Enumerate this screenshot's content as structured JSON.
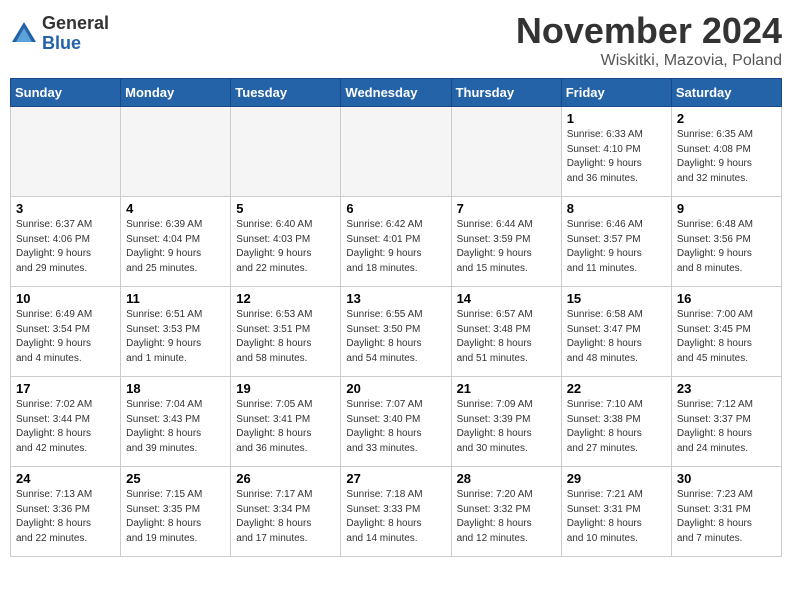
{
  "header": {
    "logo_general": "General",
    "logo_blue": "Blue",
    "month_title": "November 2024",
    "location": "Wiskitki, Mazovia, Poland"
  },
  "weekdays": [
    "Sunday",
    "Monday",
    "Tuesday",
    "Wednesday",
    "Thursday",
    "Friday",
    "Saturday"
  ],
  "weeks": [
    [
      {
        "num": "",
        "info": "",
        "empty": true
      },
      {
        "num": "",
        "info": "",
        "empty": true
      },
      {
        "num": "",
        "info": "",
        "empty": true
      },
      {
        "num": "",
        "info": "",
        "empty": true
      },
      {
        "num": "",
        "info": "",
        "empty": true
      },
      {
        "num": "1",
        "info": "Sunrise: 6:33 AM\nSunset: 4:10 PM\nDaylight: 9 hours\nand 36 minutes."
      },
      {
        "num": "2",
        "info": "Sunrise: 6:35 AM\nSunset: 4:08 PM\nDaylight: 9 hours\nand 32 minutes."
      }
    ],
    [
      {
        "num": "3",
        "info": "Sunrise: 6:37 AM\nSunset: 4:06 PM\nDaylight: 9 hours\nand 29 minutes."
      },
      {
        "num": "4",
        "info": "Sunrise: 6:39 AM\nSunset: 4:04 PM\nDaylight: 9 hours\nand 25 minutes."
      },
      {
        "num": "5",
        "info": "Sunrise: 6:40 AM\nSunset: 4:03 PM\nDaylight: 9 hours\nand 22 minutes."
      },
      {
        "num": "6",
        "info": "Sunrise: 6:42 AM\nSunset: 4:01 PM\nDaylight: 9 hours\nand 18 minutes."
      },
      {
        "num": "7",
        "info": "Sunrise: 6:44 AM\nSunset: 3:59 PM\nDaylight: 9 hours\nand 15 minutes."
      },
      {
        "num": "8",
        "info": "Sunrise: 6:46 AM\nSunset: 3:57 PM\nDaylight: 9 hours\nand 11 minutes."
      },
      {
        "num": "9",
        "info": "Sunrise: 6:48 AM\nSunset: 3:56 PM\nDaylight: 9 hours\nand 8 minutes."
      }
    ],
    [
      {
        "num": "10",
        "info": "Sunrise: 6:49 AM\nSunset: 3:54 PM\nDaylight: 9 hours\nand 4 minutes."
      },
      {
        "num": "11",
        "info": "Sunrise: 6:51 AM\nSunset: 3:53 PM\nDaylight: 9 hours\nand 1 minute."
      },
      {
        "num": "12",
        "info": "Sunrise: 6:53 AM\nSunset: 3:51 PM\nDaylight: 8 hours\nand 58 minutes."
      },
      {
        "num": "13",
        "info": "Sunrise: 6:55 AM\nSunset: 3:50 PM\nDaylight: 8 hours\nand 54 minutes."
      },
      {
        "num": "14",
        "info": "Sunrise: 6:57 AM\nSunset: 3:48 PM\nDaylight: 8 hours\nand 51 minutes."
      },
      {
        "num": "15",
        "info": "Sunrise: 6:58 AM\nSunset: 3:47 PM\nDaylight: 8 hours\nand 48 minutes."
      },
      {
        "num": "16",
        "info": "Sunrise: 7:00 AM\nSunset: 3:45 PM\nDaylight: 8 hours\nand 45 minutes."
      }
    ],
    [
      {
        "num": "17",
        "info": "Sunrise: 7:02 AM\nSunset: 3:44 PM\nDaylight: 8 hours\nand 42 minutes."
      },
      {
        "num": "18",
        "info": "Sunrise: 7:04 AM\nSunset: 3:43 PM\nDaylight: 8 hours\nand 39 minutes."
      },
      {
        "num": "19",
        "info": "Sunrise: 7:05 AM\nSunset: 3:41 PM\nDaylight: 8 hours\nand 36 minutes."
      },
      {
        "num": "20",
        "info": "Sunrise: 7:07 AM\nSunset: 3:40 PM\nDaylight: 8 hours\nand 33 minutes."
      },
      {
        "num": "21",
        "info": "Sunrise: 7:09 AM\nSunset: 3:39 PM\nDaylight: 8 hours\nand 30 minutes."
      },
      {
        "num": "22",
        "info": "Sunrise: 7:10 AM\nSunset: 3:38 PM\nDaylight: 8 hours\nand 27 minutes."
      },
      {
        "num": "23",
        "info": "Sunrise: 7:12 AM\nSunset: 3:37 PM\nDaylight: 8 hours\nand 24 minutes."
      }
    ],
    [
      {
        "num": "24",
        "info": "Sunrise: 7:13 AM\nSunset: 3:36 PM\nDaylight: 8 hours\nand 22 minutes."
      },
      {
        "num": "25",
        "info": "Sunrise: 7:15 AM\nSunset: 3:35 PM\nDaylight: 8 hours\nand 19 minutes."
      },
      {
        "num": "26",
        "info": "Sunrise: 7:17 AM\nSunset: 3:34 PM\nDaylight: 8 hours\nand 17 minutes."
      },
      {
        "num": "27",
        "info": "Sunrise: 7:18 AM\nSunset: 3:33 PM\nDaylight: 8 hours\nand 14 minutes."
      },
      {
        "num": "28",
        "info": "Sunrise: 7:20 AM\nSunset: 3:32 PM\nDaylight: 8 hours\nand 12 minutes."
      },
      {
        "num": "29",
        "info": "Sunrise: 7:21 AM\nSunset: 3:31 PM\nDaylight: 8 hours\nand 10 minutes."
      },
      {
        "num": "30",
        "info": "Sunrise: 7:23 AM\nSunset: 3:31 PM\nDaylight: 8 hours\nand 7 minutes."
      }
    ]
  ]
}
